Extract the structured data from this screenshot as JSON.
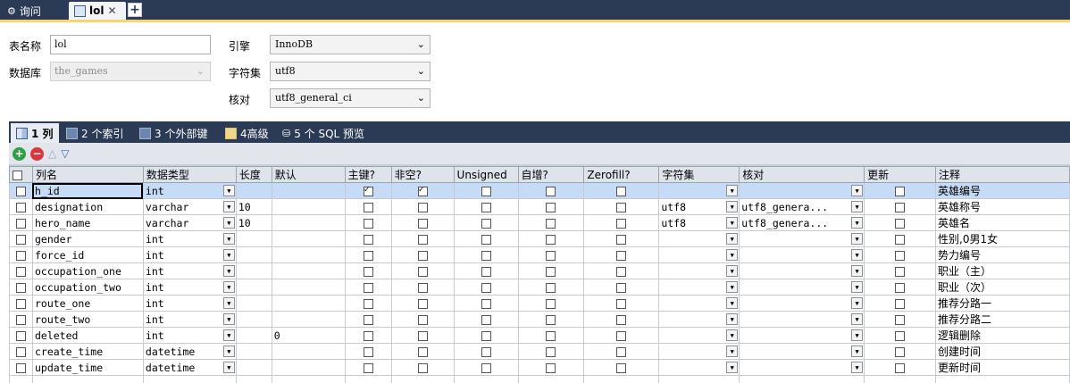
{
  "tabs": [
    {
      "label": "询问",
      "icon": "query-icon",
      "active": false
    },
    {
      "label": "lol",
      "icon": "table-icon",
      "active": true
    }
  ],
  "form": {
    "table_name_label": "表名称",
    "table_name_value": "lol",
    "database_label": "数据库",
    "database_value": "the_games",
    "engine_label": "引擎",
    "engine_value": "InnoDB",
    "charset_label": "字符集",
    "charset_value": "utf8",
    "collation_label": "核对",
    "collation_value": "utf8_general_ci"
  },
  "subtabs": [
    {
      "label": "1 列",
      "icon": "columns-icon",
      "active": true
    },
    {
      "label": "2 个索引",
      "icon": "index-icon",
      "active": false
    },
    {
      "label": "3 个外部键",
      "icon": "foreign-key-icon",
      "active": false
    },
    {
      "label": "4高级",
      "icon": "advanced-icon",
      "active": false
    },
    {
      "label": "5 个 SQL 预览",
      "icon": "sql-preview-icon",
      "active": false
    }
  ],
  "grid": {
    "headers": [
      "列名",
      "数据类型",
      "长度",
      "默认",
      "主键?",
      "非空?",
      "Unsigned",
      "自增?",
      "Zerofill?",
      "字符集",
      "核对",
      "更新",
      "注释"
    ],
    "rows": [
      {
        "name": "h_id",
        "type": "int",
        "length": "",
        "default": "",
        "pk": true,
        "notnull": true,
        "charset": "",
        "collation": "",
        "comment": "英雄编号",
        "selected": true
      },
      {
        "name": "designation",
        "type": "varchar",
        "length": "10",
        "default": "",
        "pk": false,
        "notnull": false,
        "charset": "utf8",
        "collation": "utf8_genera...",
        "comment": "英雄称号",
        "selected": false
      },
      {
        "name": "hero_name",
        "type": "varchar",
        "length": "10",
        "default": "",
        "pk": false,
        "notnull": false,
        "charset": "utf8",
        "collation": "utf8_genera...",
        "comment": "英雄名",
        "selected": false
      },
      {
        "name": "gender",
        "type": "int",
        "length": "",
        "default": "",
        "pk": false,
        "notnull": false,
        "charset": "",
        "collation": "",
        "comment": "性别,0男1女",
        "selected": false
      },
      {
        "name": "force_id",
        "type": "int",
        "length": "",
        "default": "",
        "pk": false,
        "notnull": false,
        "charset": "",
        "collation": "",
        "comment": "势力编号",
        "selected": false
      },
      {
        "name": "occupation_one",
        "type": "int",
        "length": "",
        "default": "",
        "pk": false,
        "notnull": false,
        "charset": "",
        "collation": "",
        "comment": "职业（主）",
        "selected": false
      },
      {
        "name": "occupation_two",
        "type": "int",
        "length": "",
        "default": "",
        "pk": false,
        "notnull": false,
        "charset": "",
        "collation": "",
        "comment": "职业（次）",
        "selected": false
      },
      {
        "name": "route_one",
        "type": "int",
        "length": "",
        "default": "",
        "pk": false,
        "notnull": false,
        "charset": "",
        "collation": "",
        "comment": "推荐分路一",
        "selected": false
      },
      {
        "name": "route_two",
        "type": "int",
        "length": "",
        "default": "",
        "pk": false,
        "notnull": false,
        "charset": "",
        "collation": "",
        "comment": "推荐分路二",
        "selected": false
      },
      {
        "name": "deleted",
        "type": "int",
        "length": "",
        "default": "0",
        "pk": false,
        "notnull": false,
        "charset": "",
        "collation": "",
        "comment": "逻辑删除",
        "selected": false
      },
      {
        "name": "create_time",
        "type": "datetime",
        "length": "",
        "default": "",
        "pk": false,
        "notnull": false,
        "charset": "",
        "collation": "",
        "comment": "创建时间",
        "selected": false
      },
      {
        "name": "update_time",
        "type": "datetime",
        "length": "",
        "default": "",
        "pk": false,
        "notnull": false,
        "charset": "",
        "collation": "",
        "comment": "更新时间",
        "selected": false
      }
    ]
  },
  "colors": {
    "title_bar": "#2b3a55",
    "selected_row": "#c6dbf5",
    "accent": "#f7d56b"
  }
}
